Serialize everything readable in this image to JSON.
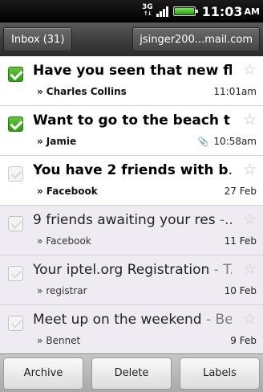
{
  "status_bar": {
    "network": "3G",
    "time": "11:03",
    "ampm": "AM",
    "battery_level": 1.0
  },
  "header": {
    "inbox_label": "Inbox (31)",
    "account_label": "jsinger200...mail.com"
  },
  "messages": [
    {
      "subject": "Have you seen that new fl",
      "snippet": "",
      "sender": "Charles Collins",
      "date": "11:01am",
      "checked": true,
      "read": false,
      "attachment": false
    },
    {
      "subject": "Want to go to the beach t",
      "snippet": " -",
      "sender": "Jamie",
      "date": "10:58am",
      "checked": true,
      "read": false,
      "attachment": true
    },
    {
      "subject": "You have 2 friends with b",
      "snippet": "",
      "sender": "Facebook",
      "date": "27 Feb",
      "checked": false,
      "read": false,
      "attachment": false
    },
    {
      "subject": "9 friends awaiting your res",
      "snippet": " -",
      "sender": "Facebook",
      "date": "11 Feb",
      "checked": false,
      "read": true,
      "attachment": false
    },
    {
      "subject": "Your iptel.org Registration",
      "snippet": " - T",
      "sender": "registrar",
      "date": "10 Feb",
      "checked": false,
      "read": true,
      "attachment": false
    },
    {
      "subject": "Meet up on the weekend",
      "snippet": " - Be",
      "sender": "Bennet",
      "date": "9 Feb",
      "checked": false,
      "read": true,
      "attachment": false
    }
  ],
  "icons": {
    "star": "star-outline-icon",
    "attachment": "paperclip-icon",
    "check": "checkbox-icon"
  },
  "actions": {
    "archive_label": "Archive",
    "delete_label": "Delete",
    "labels_label": "Labels"
  },
  "colors": {
    "unread_bg": "#ffffff",
    "read_bg": "#efebf3",
    "check_green": "#3aa81c"
  }
}
